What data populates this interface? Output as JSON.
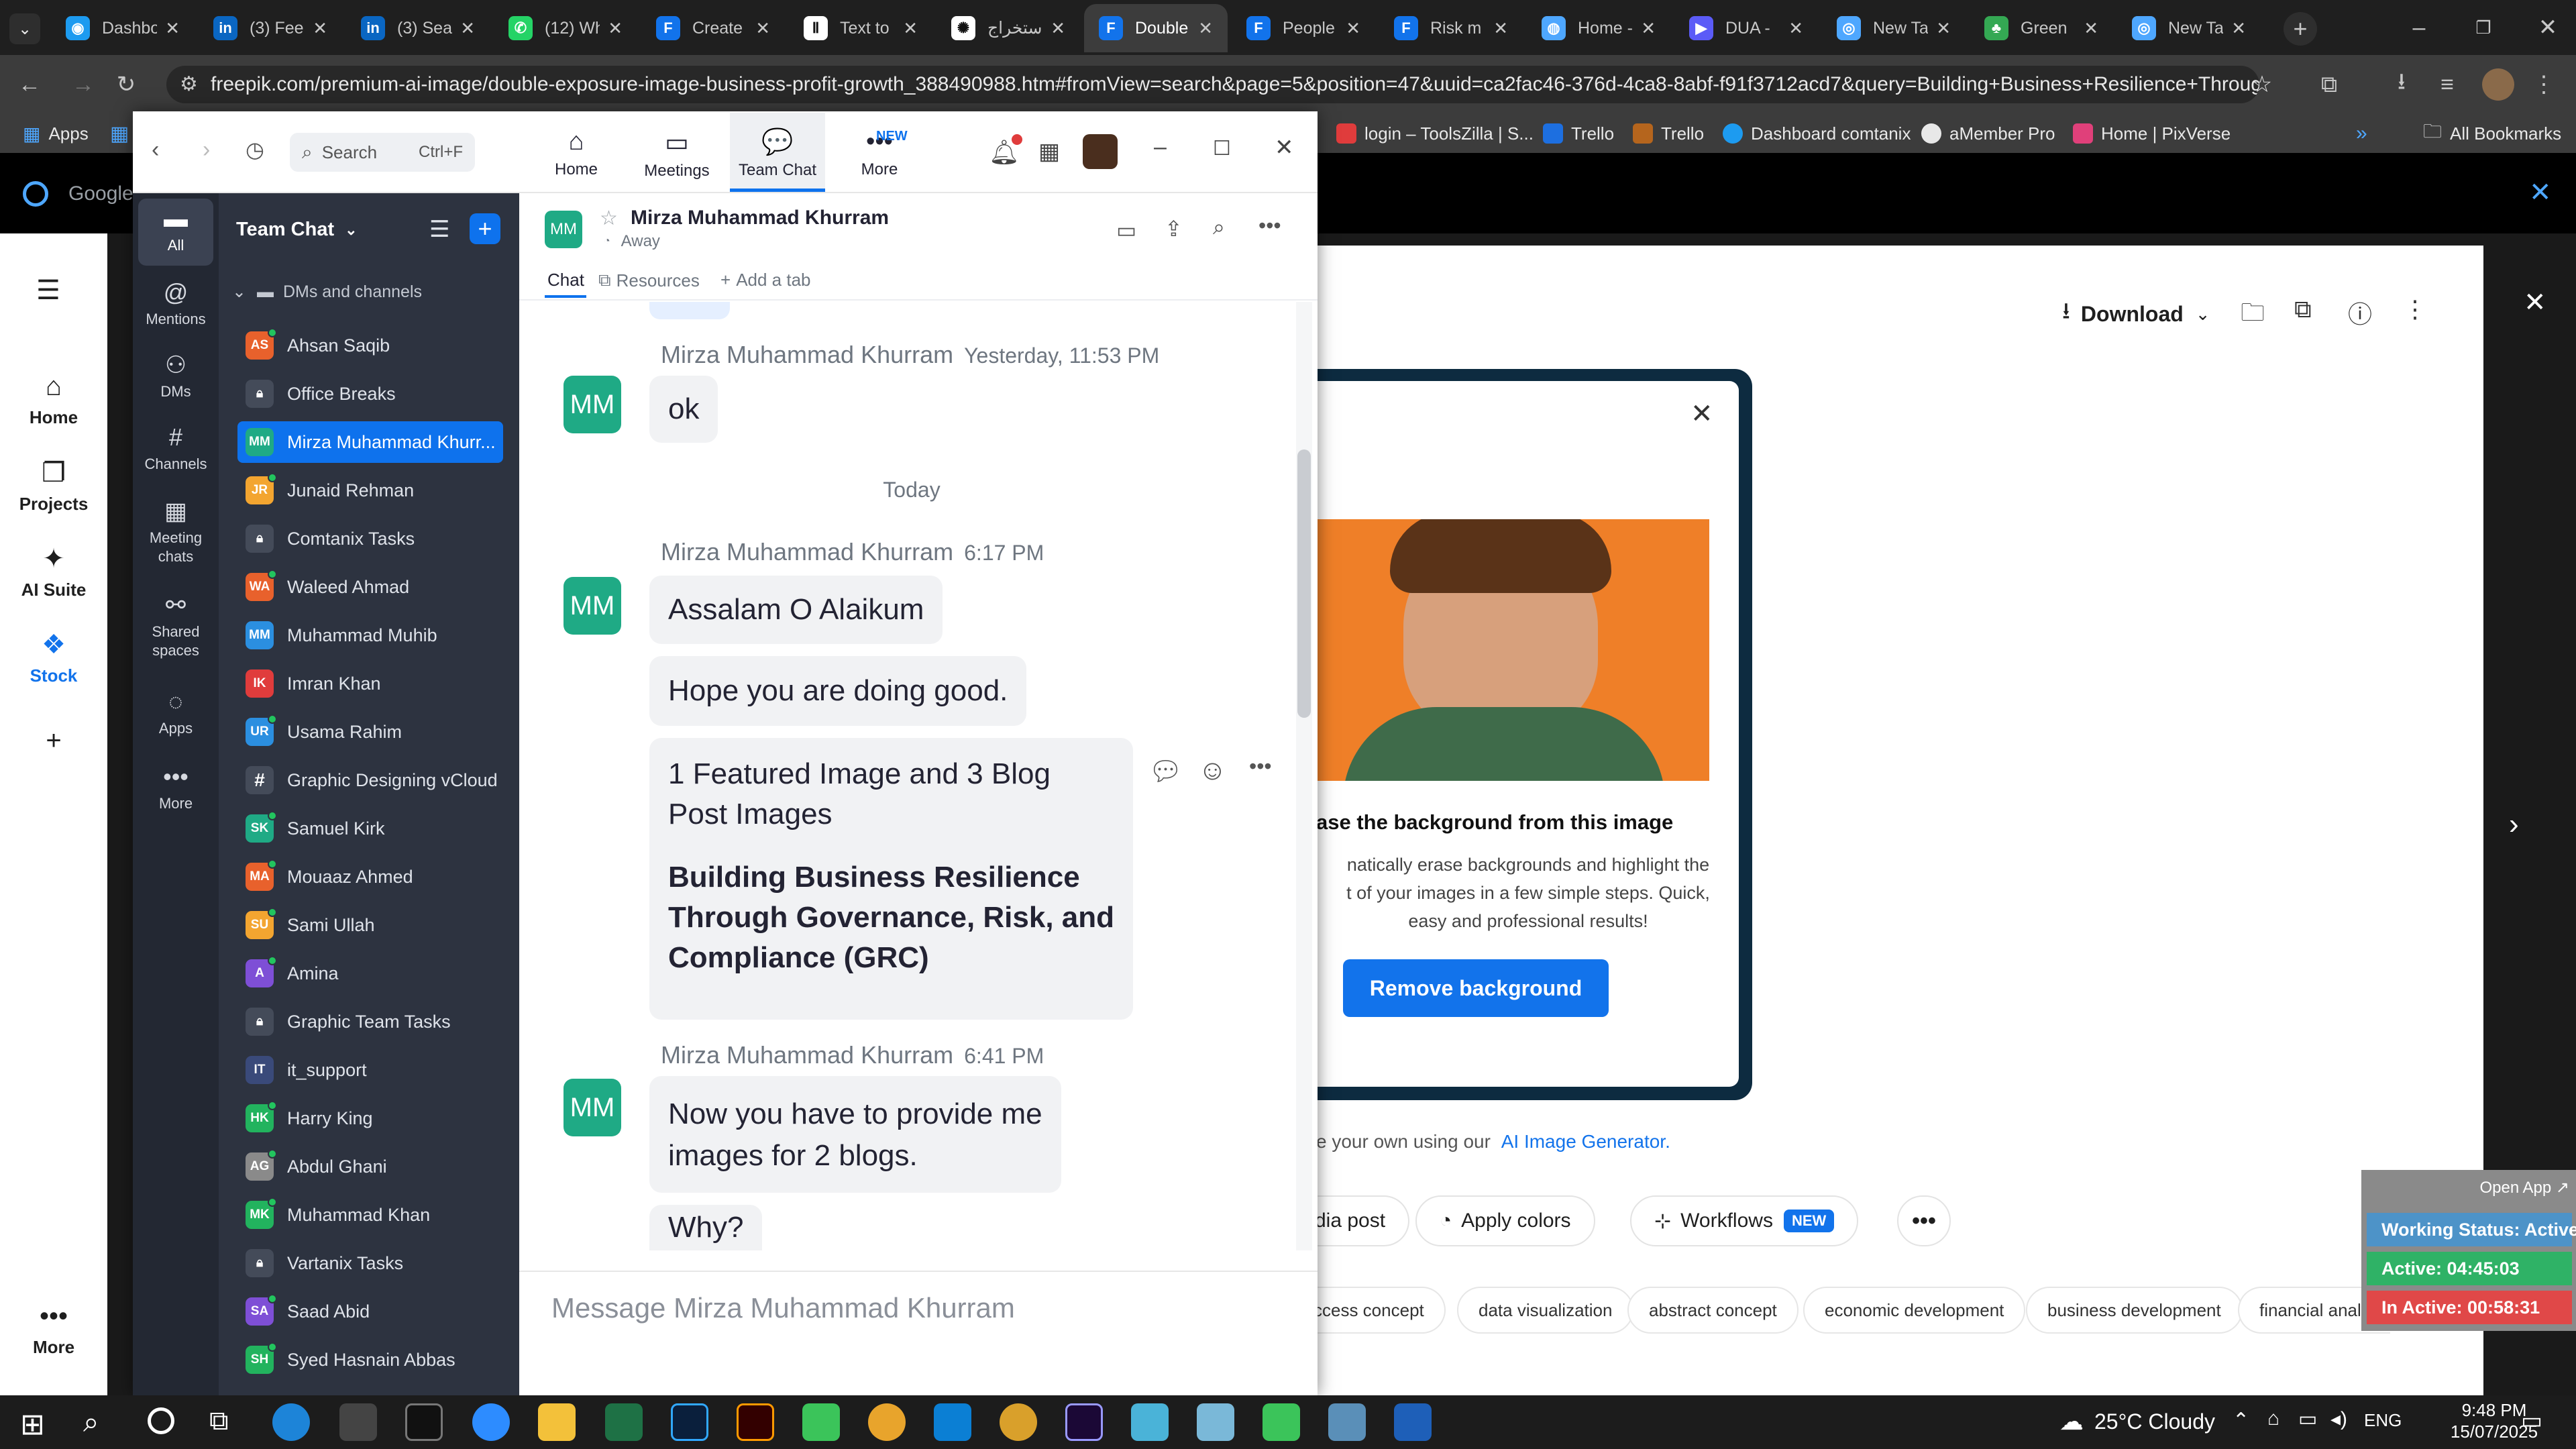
{
  "browser": {
    "tabs": [
      {
        "label": "Dashbo",
        "icon": "dashboard-icon",
        "color": "#1d9bf0"
      },
      {
        "label": "(3) Fee",
        "icon": "linkedin-icon",
        "color": "#0a66c2"
      },
      {
        "label": "(3) Sea",
        "icon": "linkedin-icon",
        "color": "#0a66c2"
      },
      {
        "label": "(12) Wh",
        "icon": "whatsapp-icon",
        "color": "#25d366"
      },
      {
        "label": "Create",
        "icon": "freepik-icon",
        "color": "#1273eb"
      },
      {
        "label": "Text to",
        "icon": "text-to-icon",
        "color": "#ffffff"
      },
      {
        "label": "استخراج",
        "icon": "openai-icon",
        "color": "#ffffff"
      },
      {
        "label": "Double",
        "icon": "freepik-icon",
        "color": "#1273eb"
      },
      {
        "label": "People",
        "icon": "freepik-icon",
        "color": "#1273eb"
      },
      {
        "label": "Risk m",
        "icon": "freepik-icon",
        "color": "#1273eb"
      },
      {
        "label": "Home -",
        "icon": "globe-icon",
        "color": "#4ea7ff"
      },
      {
        "label": "DUA -",
        "icon": "video-icon",
        "color": "#5b5bf7"
      },
      {
        "label": "New Ta",
        "icon": "chrome-icon",
        "color": "#4ea7ff"
      },
      {
        "label": "Green",
        "icon": "palm-icon",
        "color": "#34a853"
      },
      {
        "label": "New Ta",
        "icon": "chrome-icon",
        "color": "#4ea7ff"
      }
    ],
    "url": "freepik.com/premium-ai-image/double-exposure-image-business-profit-growth_388490988.htm#fromView=search&page=5&position=47&uuid=ca2fac46-376d-4ca8-8abf-f91f3712acd7&query=Building+Business+Resilience+Through+Gove...",
    "bookmarks": {
      "apps": "Apps",
      "items": [
        "login – ToolsZilla | S...",
        "Trello",
        "Trello",
        "Dashboard comtanix",
        "aMember Pro",
        "Home | PixVerse"
      ],
      "all": "All Bookmarks"
    }
  },
  "page": {
    "google_label": "Google",
    "nav": [
      {
        "label": "Home",
        "icon": "home-icon"
      },
      {
        "label": "Projects",
        "icon": "projects-icon"
      },
      {
        "label": "AI Suite",
        "icon": "ai-suite-icon"
      },
      {
        "label": "Stock",
        "icon": "stock-icon"
      },
      {
        "label": "",
        "icon": "plus-icon"
      },
      {
        "label": "More",
        "icon": "more-icon"
      }
    ],
    "download_label": "Download",
    "promo": {
      "title": "ase the background from this image",
      "line1": "natically erase backgrounds and highlight the",
      "line2": "t of your images in a few simple steps. Quick,",
      "line3": "easy and professional results!",
      "button": "Remove background"
    },
    "ai_gen_prefix": "e your own using our",
    "ai_gen_link": "AI Image Generator.",
    "chips": [
      "dia post",
      "Apply colors",
      "Workflows",
      "NEW"
    ],
    "tags": [
      "ccess concept",
      "data visualization",
      "abstract concept",
      "economic development",
      "business development",
      "financial analy"
    ],
    "tracker": {
      "open_app": "Open App ↗",
      "status": "Working Status: Active",
      "active": "Active: 04:45:03",
      "inactive": "In Active: 00:58:31"
    }
  },
  "zoom": {
    "search_placeholder": "Search",
    "search_shortcut": "Ctrl+F",
    "tabs": [
      {
        "label": "Home",
        "icon": "home-icon"
      },
      {
        "label": "Meetings",
        "icon": "meetings-icon"
      },
      {
        "label": "Team Chat",
        "icon": "team-chat-icon"
      },
      {
        "label": "More",
        "icon": "more-icon"
      }
    ],
    "more_badge": "NEW",
    "rail": [
      {
        "label": "All",
        "icon": "chat-bubble-icon"
      },
      {
        "label": "Mentions",
        "icon": "at-icon"
      },
      {
        "label": "DMs",
        "icon": "dms-icon"
      },
      {
        "label": "Channels",
        "icon": "hash-icon"
      },
      {
        "label": "Meeting\nchats",
        "icon": "calendar-icon"
      },
      {
        "label": "Shared\nspaces",
        "icon": "shared-spaces-icon"
      },
      {
        "label": "Apps",
        "icon": "apps-icon"
      },
      {
        "label": "More",
        "icon": "more-icon"
      }
    ],
    "list_title": "Team Chat",
    "section": "DMs and channels",
    "channels": [
      {
        "name": "Ahsan Saqib",
        "initials": "AS",
        "color": "#e8612c",
        "type": "dm",
        "online": true
      },
      {
        "name": "Office Breaks",
        "initials": "",
        "color": "#444b59",
        "type": "locked"
      },
      {
        "name": "Mirza Muhammad Khurr...",
        "initials": "MM",
        "color": "#1faa85",
        "type": "dm",
        "selected": true,
        "online": false
      },
      {
        "name": "Junaid Rehman",
        "initials": "JR",
        "color": "#f3a530",
        "type": "dm",
        "online": true
      },
      {
        "name": "Comtanix Tasks",
        "initials": "",
        "color": "#444b59",
        "type": "locked"
      },
      {
        "name": "Waleed Ahmad",
        "initials": "WA",
        "color": "#e8612c",
        "type": "dm",
        "online": true
      },
      {
        "name": "Muhammad Muhib",
        "initials": "MM",
        "color": "#2b8fe0",
        "type": "dm",
        "online": false
      },
      {
        "name": "Imran Khan",
        "initials": "IK",
        "color": "#e03c3c",
        "type": "dm",
        "online": false
      },
      {
        "name": "Usama Rahim",
        "initials": "UR",
        "color": "#2b8fe0",
        "type": "dm",
        "online": true
      },
      {
        "name": "Graphic Designing vCloud",
        "initials": "#",
        "color": "#444b59",
        "type": "channel"
      },
      {
        "name": "Samuel Kirk",
        "initials": "SK",
        "color": "#1faa85",
        "type": "dm",
        "online": true
      },
      {
        "name": "Mouaaz Ahmed",
        "initials": "MA",
        "color": "#e8612c",
        "type": "dm",
        "online": true
      },
      {
        "name": "Sami Ullah",
        "initials": "SU",
        "color": "#f3a530",
        "type": "dm",
        "online": true
      },
      {
        "name": "Amina",
        "initials": "A",
        "color": "#7e4fd6",
        "type": "dm",
        "online": true
      },
      {
        "name": "Graphic Team Tasks",
        "initials": "",
        "color": "#444b59",
        "type": "locked"
      },
      {
        "name": "it_support",
        "initials": "IT",
        "color": "#3a4a7a",
        "type": "dm",
        "online": false
      },
      {
        "name": "Harry King",
        "initials": "HK",
        "color": "#22b35e",
        "type": "dm",
        "online": true
      },
      {
        "name": "Abdul Ghani",
        "initials": "AG",
        "color": "#8a8a8a",
        "type": "dm",
        "online": true
      },
      {
        "name": "Muhammad Khan",
        "initials": "MK",
        "color": "#22b35e",
        "type": "dm",
        "online": true
      },
      {
        "name": "Vartanix Tasks",
        "initials": "",
        "color": "#444b59",
        "type": "locked"
      },
      {
        "name": "Saad Abid",
        "initials": "SA",
        "color": "#7e4fd6",
        "type": "dm",
        "online": true
      },
      {
        "name": "Syed Hasnain Abbas",
        "initials": "SH",
        "color": "#22b35e",
        "type": "dm",
        "online": true
      }
    ],
    "chat": {
      "contact": "Mirza Muhammad Khurram",
      "initials": "MM",
      "status": "Away",
      "tab_chat": "Chat",
      "tab_resources": "Resources",
      "tab_add": "Add a tab",
      "day_divider": "Today",
      "groups": [
        {
          "sender": "Mirza Muhammad Khurram",
          "time": "Yesterday, 11:53 PM",
          "messages": [
            "ok"
          ]
        },
        {
          "sender": "Mirza Muhammad Khurram",
          "time": "6:17 PM",
          "messages": [
            "Assalam O Alaikum",
            "Hope you are doing good."
          ],
          "rich": {
            "line1": "1 Featured Image and 3 Blog",
            "line2": "Post Images",
            "b1": "Building Business Resilience",
            "b2": "Through Governance, Risk, and",
            "b3": "Compliance (GRC)"
          }
        },
        {
          "sender": "Mirza Muhammad Khurram",
          "time": "6:41 PM",
          "messages": [
            "Now you have to provide me",
            "images for 2 blogs.",
            "Why?"
          ]
        }
      ],
      "composer_placeholder": "Message Mirza Muhammad Khurram"
    }
  },
  "taskbar": {
    "weather": "25°C  Cloudy",
    "lang": "ENG",
    "time": "9:48 PM",
    "date": "15/07/2025"
  }
}
